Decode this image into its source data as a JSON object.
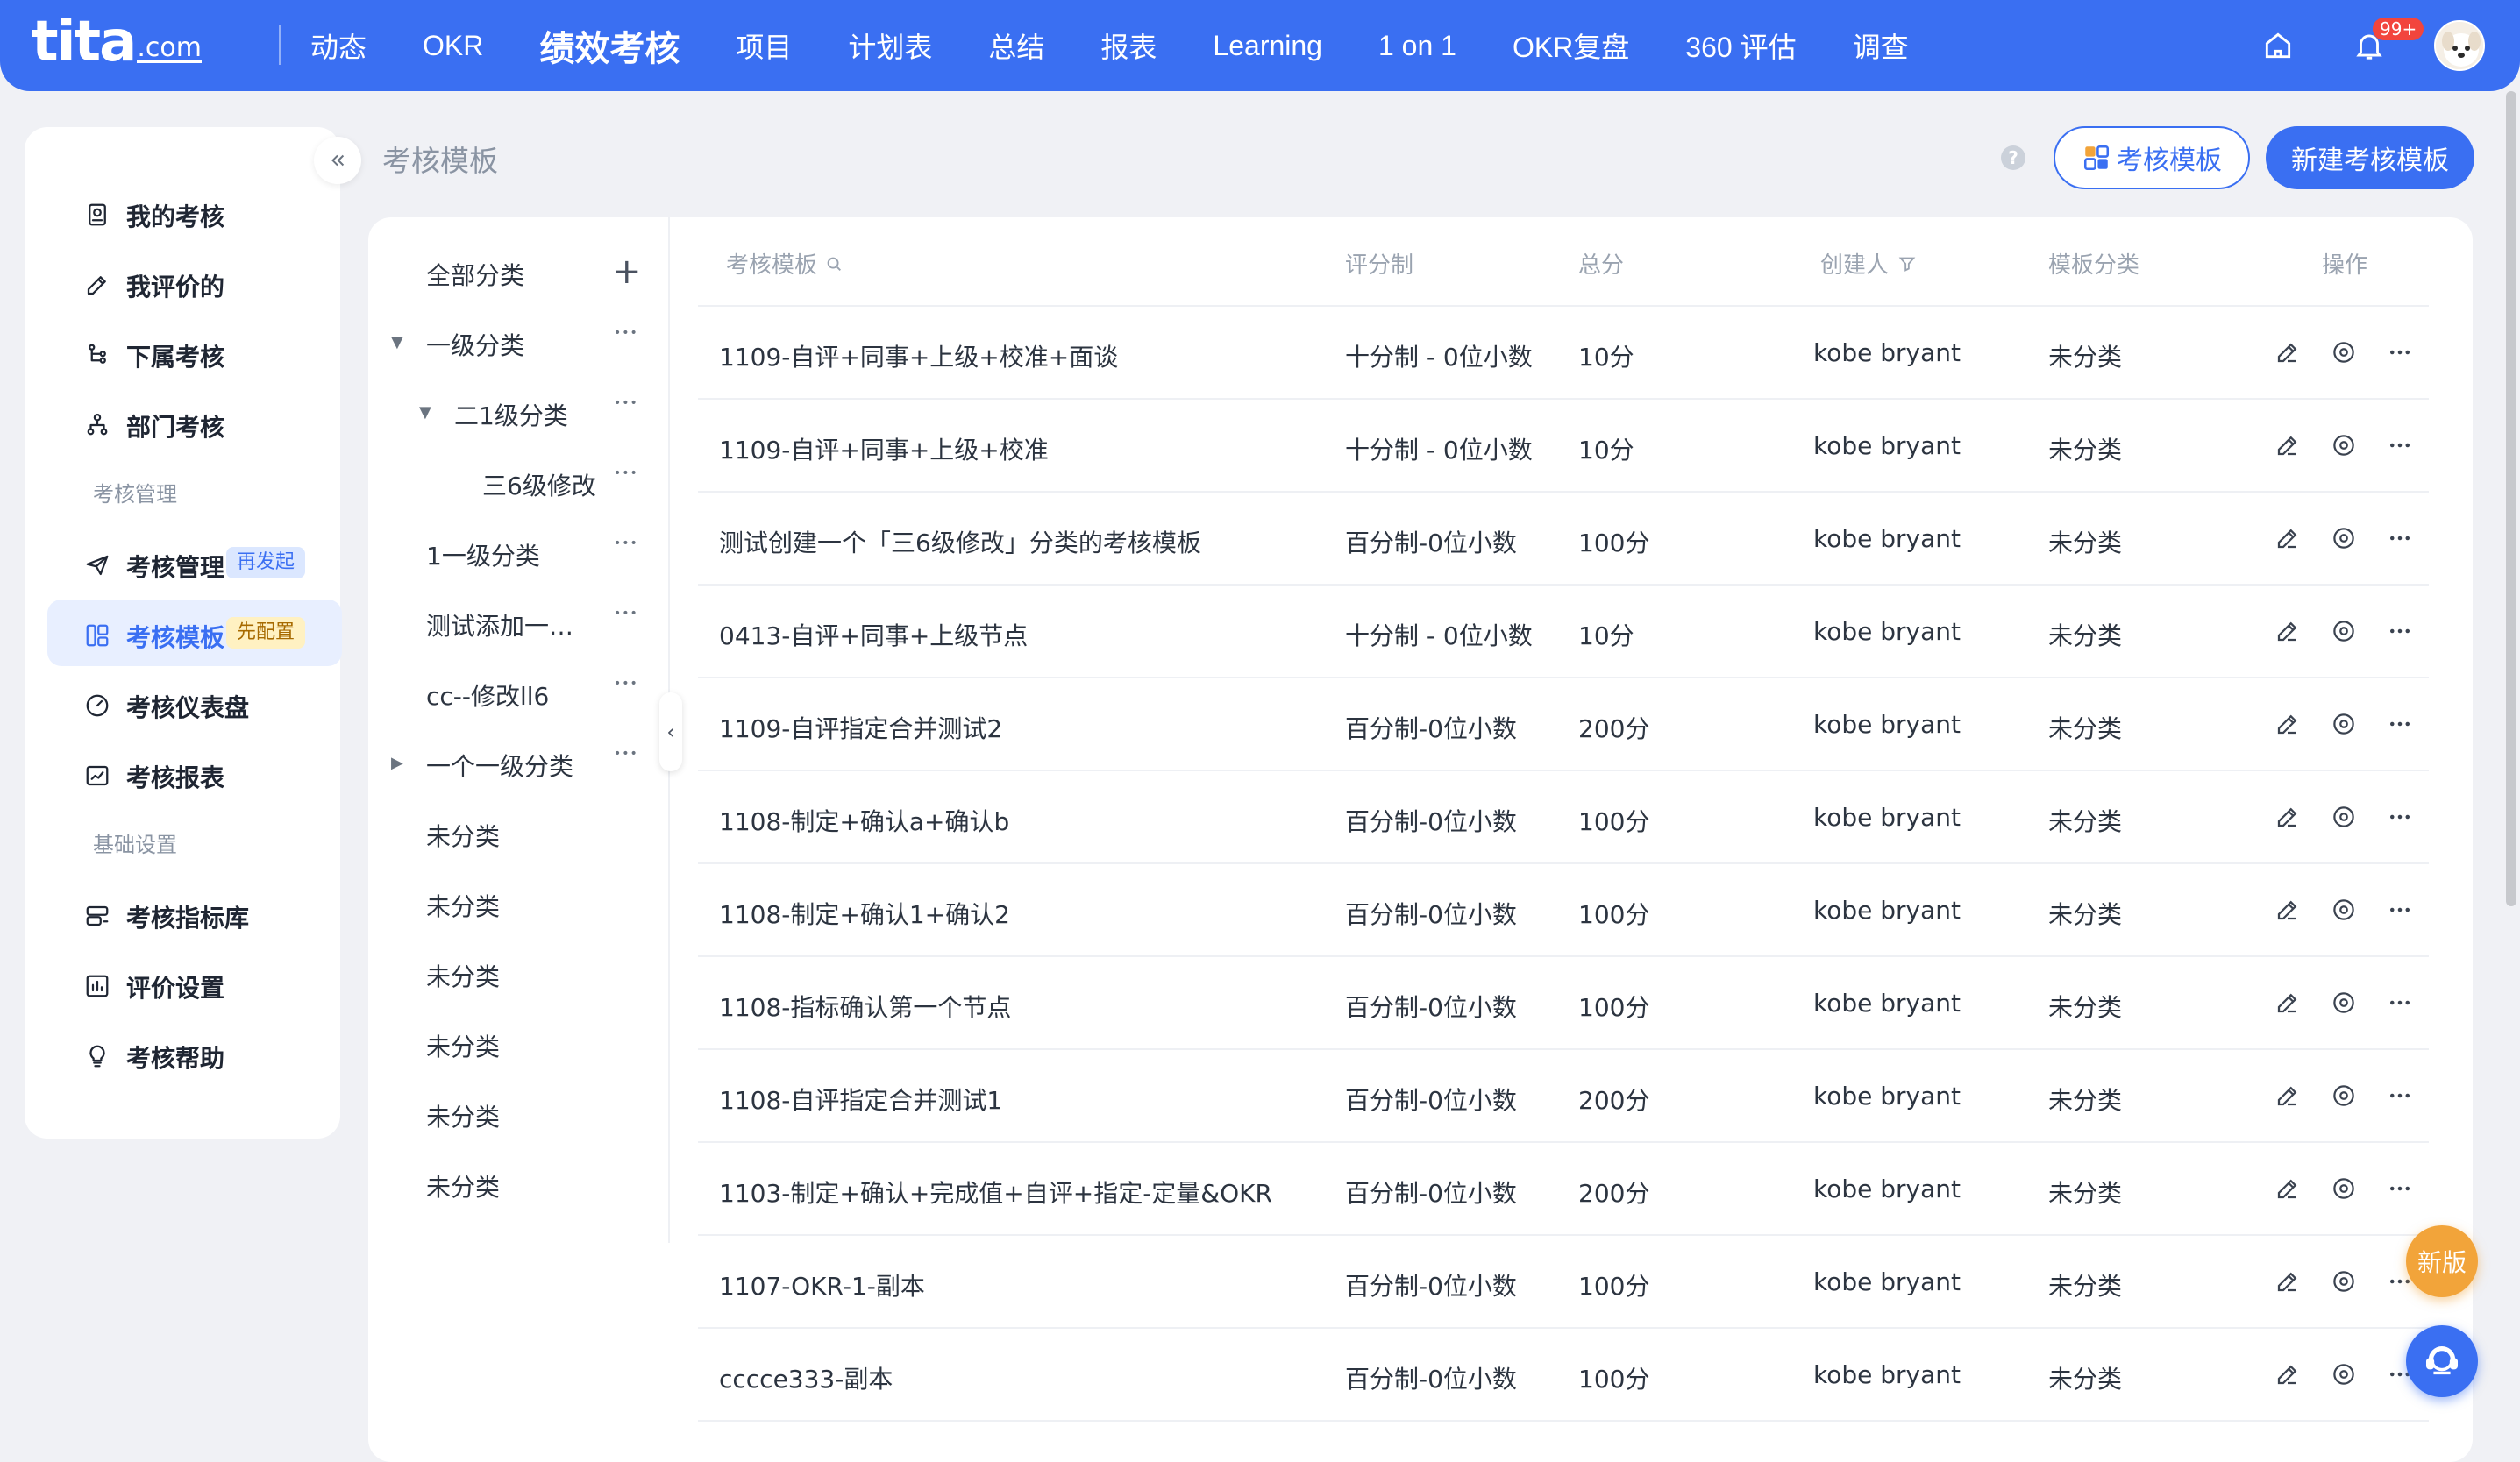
{
  "logo": {
    "brand": "tita",
    "suffix": ".com"
  },
  "nav": [
    "动态",
    "OKR",
    "绩效考核",
    "项目",
    "计划表",
    "总结",
    "报表",
    "Learning",
    "1 on 1",
    "OKR复盘",
    "360 评估",
    "调查"
  ],
  "nav_active_index": 2,
  "notifications": {
    "badge": "99+"
  },
  "sidebar": {
    "items": [
      {
        "label": "我的考核",
        "icon": "my-review-icon"
      },
      {
        "label": "我评价的",
        "icon": "pen-icon"
      },
      {
        "label": "下属考核",
        "icon": "subordinate-icon"
      },
      {
        "label": "部门考核",
        "icon": "org-icon"
      }
    ],
    "section_manage": "考核管理",
    "manage_items": [
      {
        "label": "考核管理",
        "icon": "send-icon",
        "tag": "再发起"
      },
      {
        "label": "考核模板",
        "icon": "template-icon",
        "tag": "先配置",
        "active": true
      },
      {
        "label": "考核仪表盘",
        "icon": "dashboard-icon"
      },
      {
        "label": "考核报表",
        "icon": "report-icon"
      }
    ],
    "section_basic": "基础设置",
    "basic_items": [
      {
        "label": "考核指标库",
        "icon": "indicator-icon"
      },
      {
        "label": "评价设置",
        "icon": "settings-chart-icon"
      },
      {
        "label": "考核帮助",
        "icon": "bulb-icon"
      }
    ]
  },
  "page": {
    "title": "考核模板",
    "template_button": "考核模板",
    "new_button": "新建考核模板"
  },
  "tree": {
    "items": [
      {
        "label": "全部分类",
        "level": 0
      },
      {
        "label": "一级分类",
        "level": 0,
        "arrow": "down"
      },
      {
        "label": "二1级分类",
        "level": 1,
        "arrow": "down"
      },
      {
        "label": "三6级修改",
        "level": 2
      },
      {
        "label": "1一级分类",
        "level": 0
      },
      {
        "label": "测试添加一…",
        "level": 0
      },
      {
        "label": "cc--修改ll6",
        "level": 0
      },
      {
        "label": "一个一级分类",
        "level": 0,
        "arrow": "right"
      },
      {
        "label": "未分类",
        "level": 0
      },
      {
        "label": "未分类",
        "level": 0
      },
      {
        "label": "未分类",
        "level": 0
      },
      {
        "label": "未分类",
        "level": 0
      },
      {
        "label": "未分类",
        "level": 0
      },
      {
        "label": "未分类",
        "level": 0
      }
    ]
  },
  "table": {
    "columns": [
      "考核模板",
      "评分制",
      "总分",
      "创建人",
      "模板分类",
      "操作"
    ],
    "rows": [
      {
        "name": "1109-自评+同事+上级+校准+面谈",
        "scoring": "十分制 - 0位小数",
        "total": "10分",
        "creator": "kobe bryant",
        "category": "未分类"
      },
      {
        "name": "1109-自评+同事+上级+校准",
        "scoring": "十分制 - 0位小数",
        "total": "10分",
        "creator": "kobe bryant",
        "category": "未分类"
      },
      {
        "name": "测试创建一个「三6级修改」分类的考核模板",
        "scoring": "百分制-0位小数",
        "total": "100分",
        "creator": "kobe bryant",
        "category": "未分类"
      },
      {
        "name": "0413-自评+同事+上级节点",
        "scoring": "十分制 - 0位小数",
        "total": "10分",
        "creator": "kobe bryant",
        "category": "未分类"
      },
      {
        "name": "1109-自评指定合并测试2",
        "scoring": "百分制-0位小数",
        "total": "200分",
        "creator": "kobe bryant",
        "category": "未分类"
      },
      {
        "name": "1108-制定+确认a+确认b",
        "scoring": "百分制-0位小数",
        "total": "100分",
        "creator": "kobe bryant",
        "category": "未分类"
      },
      {
        "name": "1108-制定+确认1+确认2",
        "scoring": "百分制-0位小数",
        "total": "100分",
        "creator": "kobe bryant",
        "category": "未分类"
      },
      {
        "name": "1108-指标确认第一个节点",
        "scoring": "百分制-0位小数",
        "total": "100分",
        "creator": "kobe bryant",
        "category": "未分类"
      },
      {
        "name": "1108-自评指定合并测试1",
        "scoring": "百分制-0位小数",
        "total": "200分",
        "creator": "kobe bryant",
        "category": "未分类"
      },
      {
        "name": "1103-制定+确认+完成值+自评+指定-定量&OKR",
        "scoring": "百分制-0位小数",
        "total": "200分",
        "creator": "kobe bryant",
        "category": "未分类"
      },
      {
        "name": "1107-OKR-1-副本",
        "scoring": "百分制-0位小数",
        "total": "100分",
        "creator": "kobe bryant",
        "category": "未分类"
      },
      {
        "name": "cccce333-副本",
        "scoring": "百分制-0位小数",
        "total": "100分",
        "creator": "kobe bryant",
        "category": "未分类"
      }
    ]
  },
  "floating": {
    "new_version": "新版"
  },
  "colors": {
    "primary": "#3a6ff2",
    "bg": "#f0f1f5",
    "accent_orange": "#f2a43a"
  }
}
